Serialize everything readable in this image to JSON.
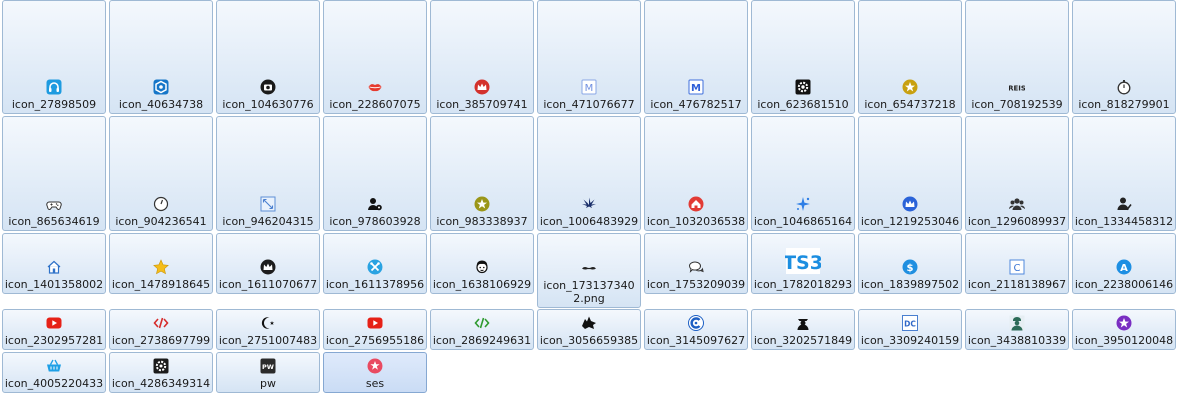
{
  "tiles": [
    {
      "name": "icon_27898509",
      "icon": "headphones-icon"
    },
    {
      "name": "icon_40634738",
      "icon": "hexagon-logo-icon"
    },
    {
      "name": "icon_104630776",
      "icon": "camera-circle-icon"
    },
    {
      "name": "icon_228607075",
      "icon": "lips-icon"
    },
    {
      "name": "icon_385709741",
      "icon": "crown-red-icon"
    },
    {
      "name": "icon_471076677",
      "icon": "letter-m-outline-icon"
    },
    {
      "name": "icon_476782517",
      "icon": "letter-m-blue-icon"
    },
    {
      "name": "icon_623681510",
      "icon": "gear-black-icon"
    },
    {
      "name": "icon_654737218",
      "icon": "star-gold-circle-icon"
    },
    {
      "name": "icon_708192539",
      "icon": "reis-text-icon",
      "text": "REIS"
    },
    {
      "name": "icon_818279901",
      "icon": "stopwatch-icon"
    },
    {
      "name": "icon_865634619",
      "icon": "gamepad-icon"
    },
    {
      "name": "icon_904236541",
      "icon": "clock-outline-icon"
    },
    {
      "name": "icon_946204315",
      "icon": "expand-arrows-icon"
    },
    {
      "name": "icon_978603928",
      "icon": "user-gear-icon"
    },
    {
      "name": "icon_983338937",
      "icon": "star-olive-circle-icon"
    },
    {
      "name": "icon_1006483929",
      "icon": "leaf-icon"
    },
    {
      "name": "icon_1032036538",
      "icon": "home-red-circle-icon"
    },
    {
      "name": "icon_1046865164",
      "icon": "sparkle-icon"
    },
    {
      "name": "icon_1219253046",
      "icon": "crown-blue-icon"
    },
    {
      "name": "icon_1296089937",
      "icon": "users-group-icon"
    },
    {
      "name": "icon_1334458312",
      "icon": "user-check-icon"
    },
    {
      "name": "icon_1401358002",
      "icon": "home-outline-icon"
    },
    {
      "name": "icon_1478918645",
      "icon": "star-yellow-icon"
    },
    {
      "name": "icon_1611070677",
      "icon": "crown-black-circle-icon"
    },
    {
      "name": "icon_1611378956",
      "icon": "tools-circle-icon"
    },
    {
      "name": "icon_1638106929",
      "icon": "face-avatar-icon"
    },
    {
      "name": "icon_1731373402.png",
      "icon": "mustache-icon"
    },
    {
      "name": "icon_1753209039",
      "icon": "chat-bubbles-icon"
    },
    {
      "name": "icon_1782018293",
      "icon": "ts3-logo-icon",
      "text": "TS3"
    },
    {
      "name": "icon_1839897502",
      "icon": "dollar-circle-icon"
    },
    {
      "name": "icon_2118138967",
      "icon": "letter-c-square-icon",
      "text": "C"
    },
    {
      "name": "icon_2238006146",
      "icon": "letter-a-circle-icon",
      "text": "A"
    },
    {
      "name": "icon_2302957281",
      "icon": "youtube-icon"
    },
    {
      "name": "icon_2738697799",
      "icon": "code-red-icon"
    },
    {
      "name": "icon_2751007483",
      "icon": "crescent-star-icon"
    },
    {
      "name": "icon_2756955186",
      "icon": "youtube-icon"
    },
    {
      "name": "icon_2869249631",
      "icon": "code-green-icon"
    },
    {
      "name": "icon_3056659385",
      "icon": "wolf-head-icon"
    },
    {
      "name": "icon_3145097627",
      "icon": "c-logo-circle-icon"
    },
    {
      "name": "icon_3202571849",
      "icon": "officer-icon"
    },
    {
      "name": "icon_3309240159",
      "icon": "dc-logo-icon"
    },
    {
      "name": "icon_3438810339",
      "icon": "soldier-icon"
    },
    {
      "name": "icon_3950120048",
      "icon": "star-purple-circle-icon"
    },
    {
      "name": "icon_4005220433",
      "icon": "basket-icon"
    },
    {
      "name": "icon_4286349314",
      "icon": "gear-dark-icon"
    },
    {
      "name": "pw",
      "icon": "pw-logo-icon",
      "text": "PW"
    },
    {
      "name": "ses",
      "icon": "ses-logo-icon",
      "selected": true
    }
  ],
  "colors": {
    "tile_border": "#9fb9d4",
    "tile_top": "#f4f8fd",
    "tile_bottom": "#d5e4f4"
  }
}
